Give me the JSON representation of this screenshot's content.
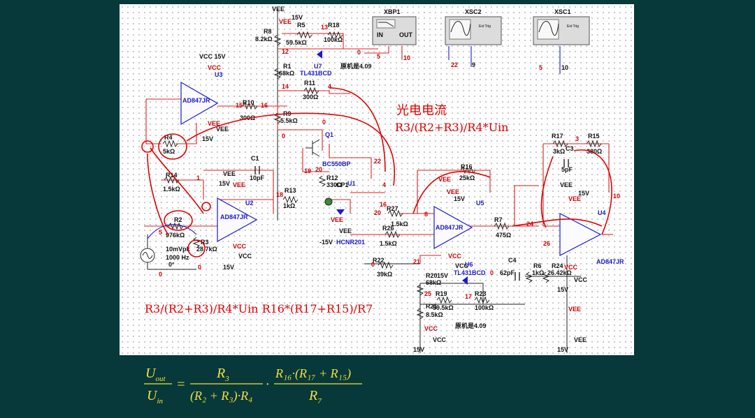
{
  "schematic": {
    "labels": {
      "vee_top": "VEE",
      "vcc_15v": "VCC 15V",
      "vcc": "VCC",
      "u3": "U3",
      "u3_part": "AD847JR",
      "u2": "U2",
      "u2_part": "AD847JR",
      "u5": "U5",
      "u5_part": "AD847JR",
      "u4": "U4",
      "u4_part": "AD847JR",
      "r8": "R8",
      "r8_val": "8.2kΩ",
      "r5": "R5",
      "r5_val": "59.5kΩ",
      "r18": "R18",
      "r18_val": "100kΩ",
      "r1": "R1",
      "r1_val": "68kΩ",
      "u7": "U7",
      "u7_part": "TL431BCD",
      "orig_409_a": "原机是4.09",
      "r11": "R11",
      "r11_val": "300Ω",
      "r10": "R10",
      "r10_val": "300Ω",
      "r9": "R9",
      "r9_val": "5.5kΩ",
      "q1": "Q1",
      "q1_part": "BC550BP",
      "r4": "R4",
      "r4_val": "5kΩ",
      "c1": "C1",
      "c1_val": "10pF",
      "r14": "R14",
      "r14_val": "1.5kΩ",
      "r12": "R12",
      "r12_val": "330Ω",
      "cp1": "CP1",
      "u1": "U1",
      "u1_part": "HCNR201",
      "r13": "R13",
      "r13_val": "1kΩ",
      "r2": "R2",
      "r2_val": "976kΩ",
      "r3": "R3",
      "r3_val": "28.7kΩ",
      "r27": "R27",
      "r27_val": "1.5kΩ",
      "r26": "R26",
      "r26_val": "1.5kΩ",
      "r22": "R22",
      "r22_val": "39kΩ",
      "r16": "R16",
      "r16_val": "25kΩ",
      "r7": "R7",
      "r7_val": "475Ω",
      "r17": "R17",
      "r17_val": "3kΩ",
      "r15": "R15",
      "r15_val": "380Ω",
      "c3": "C3",
      "c3_val": "5pF",
      "c4": "C4",
      "c4_val": "62pF",
      "r6": "R6",
      "r6_val": "1kΩ",
      "r24": "R24",
      "r24_val": "26.42kΩ",
      "u6": "U6",
      "u6_part": "TL431BCD",
      "r20": "R20",
      "r20_val": "68kΩ",
      "r19": "R19",
      "r19_val": "59.5kΩ",
      "r23": "R23",
      "r23_val": "100kΩ",
      "r21": "R21",
      "r21_val": "8.5kΩ",
      "orig_409_b": "原机是4.09",
      "src": "10mVpk",
      "src_freq": "1000 Hz",
      "src_phase": "0°",
      "v15": "15V",
      "vm15": "-15V",
      "xbp1": "XBP1",
      "xsc2": "XSC2",
      "xsc1": "XSC1",
      "in": "IN",
      "out": "OUT",
      "ext_trig": "Ext Trig",
      "vee": "VEE",
      "n12": "12",
      "n13": "13",
      "n14": "14",
      "n15": "15",
      "n16": "16",
      "n4": "4",
      "n5": "5",
      "n10": "10",
      "n22": "22",
      "n9": "9",
      "n3": "3",
      "n1": "1",
      "n18": "18",
      "n19": "19",
      "n20": "20",
      "n8": "8",
      "n24": "24",
      "n26": "26",
      "n21": "21",
      "n17": "17",
      "n25": "25",
      "n0": "0"
    },
    "annotations": {
      "photo_current": "光电电流",
      "formula_a": "R3/(R2+R3)/R4*Uin",
      "formula_b": "R3/(R2+R3)/R4*Uin R16*(R17+R15)/R7"
    }
  },
  "formula": {
    "lhs_num": "U",
    "lhs_num_sub": "out",
    "lhs_den": "U",
    "lhs_den_sub": "in",
    "eq": "=",
    "f1_num": "R",
    "f1_num_sub": "3",
    "f1_den": "(R₂ + R₃)·R₄",
    "dot": "·",
    "f2_num": "R₁₆·(R₁₇ + R₁₅)",
    "f2_den": "R",
    "f2_den_sub": "7"
  },
  "colors": {
    "background": "#07383a",
    "annotation": "#e00000",
    "formula": "#f0e040",
    "wire_red": "#e02020",
    "wire_blue": "#1a1ad0"
  }
}
